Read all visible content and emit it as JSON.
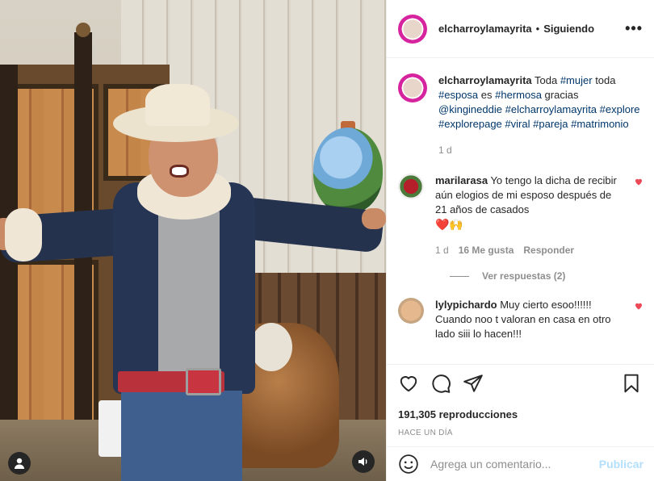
{
  "post": {
    "username": "elcharroylamayrita",
    "separator": "•",
    "follow_status": "Siguiendo",
    "more_label": "•••"
  },
  "caption": {
    "username": "elcharroylamayrita",
    "parts": [
      "Toda ",
      "#mujer",
      " toda ",
      "#esposa",
      " es ",
      "#hermosa",
      " gracias ",
      "@kingineddie",
      " ",
      "#elcharroylamayrita",
      " ",
      "#explore",
      " ",
      "#explorepage",
      " ",
      "#viral",
      " ",
      "#pareja",
      " ",
      "#matrimonio"
    ],
    "age": "1 d"
  },
  "comments": [
    {
      "username": "marilarasa",
      "text": "Yo tengo la dicha de recibir aún elogios de mi esposo después de 21 años de casados",
      "emojis": "❤️🙌",
      "age": "1 d",
      "likes": "16 Me gusta",
      "reply_label": "Responder",
      "view_replies": "Ver respuestas (2)"
    },
    {
      "username": "lylypichardo",
      "text": "Muy cierto esoo!!!!!! Cuando noo t valoran en casa en otro lado siii lo hacen!!!"
    }
  ],
  "stats": {
    "views": "191,305 reproducciones",
    "posted": "HACE UN DÍA"
  },
  "add_comment": {
    "placeholder": "Agrega un comentario...",
    "publish_label": "Publicar"
  },
  "colors": {
    "link": "#00376b",
    "heart": "#ed4956",
    "muted": "#8e8e8e",
    "publish_disabled": "#b2dffc"
  },
  "icons": {
    "like": "heart-icon",
    "comment": "comment-icon",
    "share": "paper-plane-icon",
    "save": "bookmark-icon",
    "emoji": "smiley-icon",
    "user_tag": "user-icon",
    "audio": "speaker-icon"
  }
}
